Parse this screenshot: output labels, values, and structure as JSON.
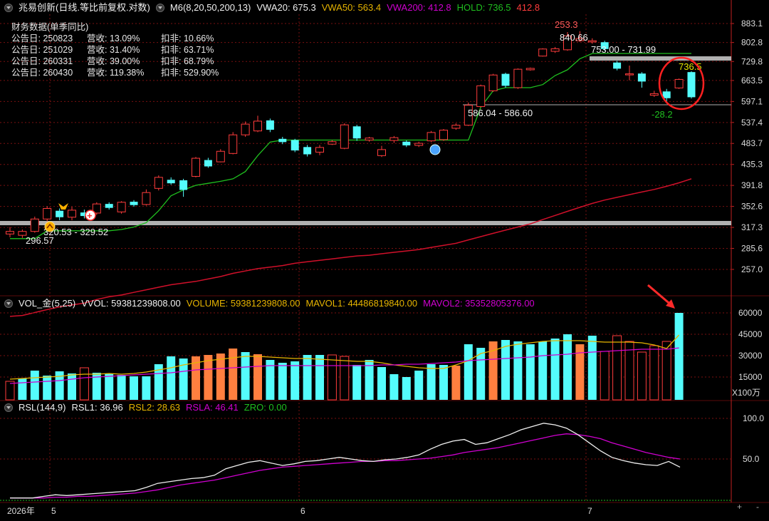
{
  "header": {
    "stock": "兆易创新(日线.等比前复权.对数)",
    "m6": "M6(8,20,50,200,13)",
    "vwa20": "VWA20: 675.3",
    "vwa50": "VWA50: 563.4",
    "vwa200": "VWA200: 412.8",
    "hold": "HOLD: 736.5",
    "hold2": "412.8"
  },
  "finance": {
    "title": "财务数据(单季同比)",
    "rows": [
      {
        "date": "公告日: 250823",
        "rev": "营收:  13.09%",
        "nonrec": "扣非:  10.66%"
      },
      {
        "date": "公告日: 251029",
        "rev": "营收:  31.40%",
        "nonrec": "扣非:  63.71%"
      },
      {
        "date": "公告日: 260331",
        "rev": "营收:  39.00%",
        "nonrec": "扣非:  68.79%"
      },
      {
        "date": "公告日: 260430",
        "rev": "营收:  119.38%",
        "nonrec": "扣非:  529.90%"
      }
    ]
  },
  "vol_header": {
    "name": "VOL_金(5,25)",
    "vvol": "VVOL: 59381239808.00",
    "volume": "VOLUME: 59381239808.00",
    "mavol1": "MAVOL1: 44486819840.00",
    "mavol2": "MAVOL2: 35352805376.00"
  },
  "rsl_header": {
    "name": "RSL(144,9)",
    "rsl1": "RSL1: 36.96",
    "rsl2": "RSL2: 28.63",
    "rsla": "RSLA: 46.41",
    "zro": "ZRO: 0.00"
  },
  "colors": {
    "up": "#ff3c3c",
    "down": "#54fcfc",
    "orange": "#ff7f3f",
    "green": "#1fbf1f",
    "ma200": "#d0102a",
    "yellow": "#e6b400",
    "magenta": "#d000d0",
    "white": "#f0f0f0",
    "grid": "#7a1010",
    "axis": "#c02020",
    "hline": "#b0b0b0"
  },
  "x_axis": {
    "year_label": "2026年",
    "month_labels": [
      "5",
      "6",
      "7"
    ]
  },
  "axis_unit": "X100万",
  "chart_data": [
    {
      "type": "candlestick",
      "y_scale": "log",
      "y_ticks": [
        883.1,
        802.8,
        729.8,
        663.5,
        597.1,
        537.4,
        483.7,
        435.3,
        391.8,
        352.6,
        317.3,
        285.6,
        257.0
      ],
      "candles": [
        {
          "o": 307,
          "c": 311,
          "h": 318,
          "l": 302
        },
        {
          "o": 305,
          "c": 311,
          "h": 314,
          "l": 301
        },
        {
          "o": 311,
          "c": 331,
          "h": 335,
          "l": 309
        },
        {
          "o": 331,
          "c": 349,
          "h": 353,
          "l": 327
        },
        {
          "o": 345,
          "c": 334,
          "h": 349,
          "l": 329
        },
        {
          "o": 334,
          "c": 346,
          "h": 352,
          "l": 329
        },
        {
          "o": 342,
          "c": 336,
          "h": 347,
          "l": 332
        },
        {
          "o": 341,
          "c": 357,
          "h": 360,
          "l": 338
        },
        {
          "o": 357,
          "c": 350,
          "h": 360,
          "l": 347
        },
        {
          "o": 343,
          "c": 360,
          "h": 362,
          "l": 340
        },
        {
          "o": 361,
          "c": 355,
          "h": 364,
          "l": 352
        },
        {
          "o": 356,
          "c": 378,
          "h": 384,
          "l": 354
        },
        {
          "o": 386,
          "c": 408,
          "h": 412,
          "l": 382
        },
        {
          "o": 403,
          "c": 396,
          "h": 408,
          "l": 393
        },
        {
          "o": 402,
          "c": 383,
          "h": 405,
          "l": 370
        },
        {
          "o": 410,
          "c": 449,
          "h": 452,
          "l": 408
        },
        {
          "o": 445,
          "c": 431,
          "h": 450,
          "l": 428
        },
        {
          "o": 441,
          "c": 465,
          "h": 470,
          "l": 440
        },
        {
          "o": 460,
          "c": 505,
          "h": 512,
          "l": 458
        },
        {
          "o": 505,
          "c": 533,
          "h": 540,
          "l": 500
        },
        {
          "o": 515,
          "c": 541,
          "h": 556,
          "l": 512
        },
        {
          "o": 543,
          "c": 518,
          "h": 548,
          "l": 512
        },
        {
          "o": 495,
          "c": 487,
          "h": 500,
          "l": 482
        },
        {
          "o": 492,
          "c": 467,
          "h": 495,
          "l": 463
        },
        {
          "o": 475,
          "c": 458,
          "h": 480,
          "l": 453
        },
        {
          "o": 463,
          "c": 474,
          "h": 480,
          "l": 456
        },
        {
          "o": 482,
          "c": 488,
          "h": 492,
          "l": 480
        },
        {
          "o": 472,
          "c": 531,
          "h": 535,
          "l": 470
        },
        {
          "o": 527,
          "c": 496,
          "h": 531,
          "l": 490
        },
        {
          "o": 492,
          "c": 497,
          "h": 500,
          "l": 488
        },
        {
          "o": 455,
          "c": 469,
          "h": 478,
          "l": 452
        },
        {
          "o": 491,
          "c": 498,
          "h": 502,
          "l": 485
        },
        {
          "o": 488,
          "c": 479,
          "h": 491,
          "l": 475
        },
        {
          "o": 479,
          "c": 484,
          "h": 488,
          "l": 475
        },
        {
          "o": 490,
          "c": 511,
          "h": 515,
          "l": 487
        },
        {
          "o": 493,
          "c": 517,
          "h": 520,
          "l": 490
        },
        {
          "o": 522,
          "c": 530,
          "h": 535,
          "l": 518
        },
        {
          "o": 530,
          "c": 586,
          "h": 594,
          "l": 528
        },
        {
          "o": 582,
          "c": 646,
          "h": 650,
          "l": 580
        },
        {
          "o": 630,
          "c": 682,
          "h": 686,
          "l": 627
        },
        {
          "o": 686,
          "c": 646,
          "h": 690,
          "l": 640
        },
        {
          "o": 640,
          "c": 702,
          "h": 705,
          "l": 636
        },
        {
          "o": 700,
          "c": 705,
          "h": 708,
          "l": 697
        },
        {
          "o": 750,
          "c": 777,
          "h": 780,
          "l": 748
        },
        {
          "o": 768,
          "c": 778,
          "h": 785,
          "l": 762
        },
        {
          "o": 774,
          "c": 830,
          "h": 846,
          "l": 770
        },
        {
          "o": 810,
          "c": 819,
          "h": 850,
          "l": 805
        },
        {
          "o": 805,
          "c": 810,
          "h": 820,
          "l": 798
        },
        {
          "o": 804,
          "c": 777,
          "h": 810,
          "l": 770
        },
        {
          "o": 726,
          "c": 704,
          "h": 732,
          "l": 698
        },
        {
          "o": 683,
          "c": 686,
          "h": 715,
          "l": 664
        },
        {
          "o": 687,
          "c": 660,
          "h": 692,
          "l": 640
        },
        {
          "o": 616,
          "c": 621,
          "h": 630,
          "l": 611
        },
        {
          "o": 628,
          "c": 607,
          "h": 636,
          "l": 592
        },
        {
          "o": 639,
          "c": 667,
          "h": 670,
          "l": 636
        },
        {
          "o": 692,
          "c": 610,
          "h": 695,
          "l": 606
        }
      ],
      "ma_green": [
        300,
        300,
        300,
        312,
        312,
        312,
        312,
        312,
        312,
        314,
        318,
        325,
        345,
        372,
        383,
        392,
        396,
        400,
        405,
        420,
        455,
        487,
        492,
        492,
        492,
        492,
        492,
        492,
        492,
        492,
        492,
        492,
        492,
        492,
        492,
        492,
        492,
        492,
        580,
        630,
        640,
        640,
        640,
        650,
        680,
        700,
        740,
        760,
        760,
        760,
        760,
        760,
        760,
        760,
        760,
        760
      ],
      "ma200": [
        203,
        204,
        207,
        210,
        213,
        215,
        217,
        221,
        224,
        226,
        229,
        232,
        235,
        238,
        240,
        242,
        245,
        248,
        252,
        255,
        258,
        260,
        262,
        265,
        267,
        269,
        271,
        273,
        275,
        276,
        278,
        280,
        282,
        284,
        287,
        290,
        293,
        298,
        303,
        308,
        313,
        318,
        323,
        330,
        337,
        344,
        351,
        358,
        364,
        369,
        374,
        379,
        384,
        390,
        397,
        405
      ],
      "annotations": {
        "high": "253.3",
        "high2": "840.66",
        "range_top": "753.00 - 731.99",
        "range_mid": "586.04 - 586.60",
        "range_low": "320.53 - 329.52",
        "low": "296.57",
        "last": "736.5",
        "diff": "-28.2"
      }
    },
    {
      "type": "bar",
      "y_ticks": [
        60000,
        45000,
        30000,
        15000
      ],
      "values": [
        12000,
        14000,
        19500,
        16000,
        19000,
        17500,
        21500,
        18000,
        17500,
        16500,
        15500,
        15500,
        24000,
        29500,
        28000,
        29500,
        30500,
        31500,
        35000,
        32500,
        31000,
        27000,
        25000,
        26000,
        30500,
        30500,
        30500,
        29500,
        23500,
        27000,
        22000,
        17000,
        15000,
        19500,
        24000,
        23500,
        23000,
        38000,
        35500,
        40000,
        41000,
        40000,
        38000,
        40000,
        42000,
        45000,
        38000,
        44000,
        33000,
        44000,
        40000,
        32500,
        37000,
        40000,
        60000
      ],
      "colors_code": "urrddruddddrrrroooodorrddduudrrrrrddorrodrddrroduuuuuurd",
      "mavol1": [
        13500,
        14000,
        14500,
        15000,
        15500,
        16500,
        17000,
        17000,
        17500,
        17000,
        17500,
        18500,
        20000,
        21500,
        23500,
        25000,
        26500,
        27500,
        28500,
        29500,
        29500,
        29000,
        28500,
        28000,
        28000,
        27500,
        27000,
        26500,
        26000,
        26000,
        25000,
        23500,
        22500,
        21500,
        21000,
        21000,
        23500,
        26500,
        31500,
        33500,
        36500,
        38000,
        39000,
        40000,
        40500,
        40500,
        40500,
        40000,
        39500,
        39500,
        39500,
        39000,
        37500,
        35000,
        44500
      ],
      "mavol2": [
        10500,
        11000,
        11500,
        12000,
        12500,
        13500,
        14500,
        15000,
        15500,
        16000,
        16500,
        17000,
        17500,
        18000,
        19000,
        20000,
        20500,
        21000,
        21500,
        22000,
        22500,
        23000,
        23000,
        23000,
        23000,
        23000,
        23000,
        23000,
        23000,
        23000,
        23500,
        23500,
        24000,
        24000,
        24500,
        25000,
        25500,
        26500,
        27000,
        27500,
        28000,
        28500,
        29000,
        30000,
        30500,
        31000,
        32000,
        32500,
        33000,
        33500,
        34000,
        34500,
        34500,
        34500,
        35400
      ]
    },
    {
      "type": "line",
      "y_ticks": [
        100.0,
        50.0
      ],
      "rsl_white": [
        2,
        2,
        2,
        4,
        6,
        5,
        6,
        7,
        8,
        9,
        10,
        11,
        15,
        20,
        22,
        24,
        26,
        27,
        30,
        38,
        42,
        46,
        48,
        45,
        42,
        44,
        47,
        48,
        50,
        52,
        50,
        48,
        47,
        49,
        50,
        52,
        55,
        62,
        68,
        72,
        74,
        68,
        70,
        75,
        80,
        86,
        90,
        94,
        92,
        88,
        80,
        70,
        60,
        52,
        48,
        45,
        43,
        42,
        47,
        40
      ],
      "rsla_magenta": [
        2,
        2,
        2,
        2,
        3,
        3,
        4,
        4,
        5,
        6,
        7,
        8,
        10,
        12,
        15,
        18,
        20,
        22,
        24,
        27,
        30,
        33,
        36,
        38,
        40,
        41,
        42,
        43,
        44,
        45,
        46,
        47,
        47,
        48,
        48,
        49,
        50,
        51,
        53,
        55,
        58,
        60,
        62,
        64,
        67,
        70,
        73,
        76,
        79,
        81,
        80,
        78,
        75,
        70,
        66,
        62,
        58,
        55,
        52,
        50
      ]
    }
  ]
}
